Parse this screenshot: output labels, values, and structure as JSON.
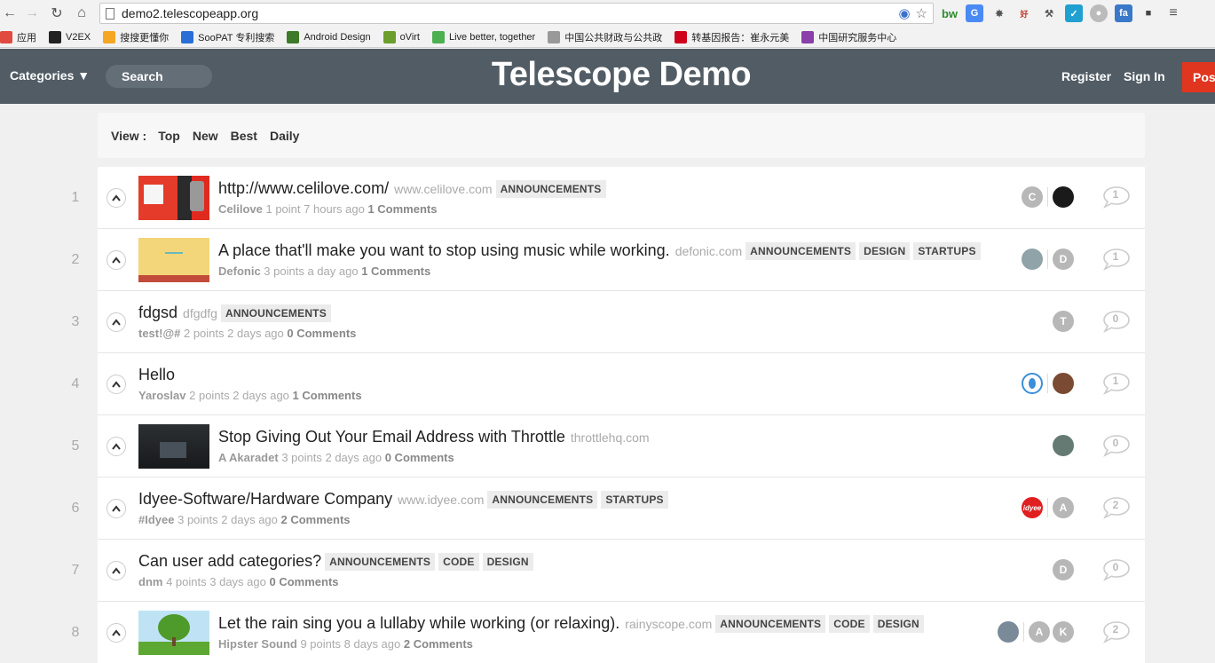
{
  "browser": {
    "url": "demo2.telescopeapp.org",
    "bookmarks": [
      {
        "label": "应用",
        "icon": "apps-grid-icon",
        "color": "#e04a3f"
      },
      {
        "label": "V2EX",
        "icon": "v2ex-icon",
        "color": "#222222"
      },
      {
        "label": "搜搜更懂你",
        "icon": "soso-icon",
        "color": "#f5a623"
      },
      {
        "label": "SooPAT 专利搜索",
        "icon": "soopat-icon",
        "color": "#2a6fd6"
      },
      {
        "label": "Android Design",
        "icon": "android-design-icon",
        "color": "#3d7a2a"
      },
      {
        "label": "oVirt",
        "icon": "ovirt-icon",
        "color": "#6b9e2c"
      },
      {
        "label": "Live better, together",
        "icon": "live-better-icon",
        "color": "#4caf50"
      },
      {
        "label": "中国公共财政与公共政",
        "icon": "page-icon",
        "color": "#999999"
      },
      {
        "label": "转基因报告：崔永元美",
        "icon": "video-icon",
        "color": "#d0021b"
      },
      {
        "label": "中国研究服务中心",
        "icon": "usc-icon",
        "color": "#8b3fa8"
      }
    ]
  },
  "header": {
    "categories_label": "Categories ▼",
    "search_placeholder": "Search",
    "site_title": "Telescope Demo",
    "register_label": "Register",
    "signin_label": "Sign In",
    "post_label": "Post"
  },
  "view_bar": {
    "label": "View :",
    "options": [
      "Top",
      "New",
      "Best",
      "Daily"
    ]
  },
  "posts": [
    {
      "rank": "1",
      "title": "http://www.celilove.com/",
      "domain": "www.celilove.com",
      "tags": [
        "ANNOUNCEMENTS"
      ],
      "author": "Celilove",
      "points": "1 point",
      "time": "7 hours ago",
      "comments_label": "1 Comments",
      "comment_count": "1",
      "thumb": "celilove",
      "avatars": [
        {
          "letter": "C",
          "color": "#b7b7b7"
        },
        {
          "divider": true
        },
        {
          "letter": "",
          "color": "#1a1a1a",
          "photo": "dark"
        }
      ]
    },
    {
      "rank": "2",
      "title": "A place that'll make you want to stop using music while working.",
      "domain": "defonic.com",
      "tags": [
        "ANNOUNCEMENTS",
        "DESIGN",
        "STARTUPS"
      ],
      "author": "Defonic",
      "points": "3 points",
      "time": "a day ago",
      "comments_label": "1 Comments",
      "comment_count": "1",
      "thumb": "defonic",
      "avatars": [
        {
          "letter": "",
          "color": "#8fa3a8",
          "photo": "gray"
        },
        {
          "divider": true
        },
        {
          "letter": "D",
          "color": "#b7b7b7"
        }
      ]
    },
    {
      "rank": "3",
      "title": "fdgsd",
      "domain": "dfgdfg",
      "tags": [
        "ANNOUNCEMENTS"
      ],
      "author": "test!@#",
      "points": "2 points",
      "time": "2 days ago",
      "comments_label": "0 Comments",
      "comment_count": "0",
      "thumb": "",
      "avatars": [
        {
          "letter": "T",
          "color": "#b7b7b7"
        }
      ]
    },
    {
      "rank": "4",
      "title": "Hello",
      "domain": "",
      "tags": [],
      "author": "Yaroslav",
      "points": "2 points",
      "time": "2 days ago",
      "comments_label": "1 Comments",
      "comment_count": "1",
      "thumb": "",
      "avatars": [
        {
          "letter": "",
          "color": "#3a8fd8",
          "photo": "ring"
        },
        {
          "divider": true
        },
        {
          "letter": "",
          "color": "#7a4a32",
          "photo": "brown"
        }
      ]
    },
    {
      "rank": "5",
      "title": "Stop Giving Out Your Email Address with Throttle",
      "domain": "throttlehq.com",
      "tags": [],
      "author": "A Akaradet",
      "points": "3 points",
      "time": "2 days ago",
      "comments_label": "0 Comments",
      "comment_count": "0",
      "thumb": "throttle",
      "avatars": [
        {
          "letter": "",
          "color": "#667a74",
          "photo": "gray"
        }
      ]
    },
    {
      "rank": "6",
      "title": "Idyee-Software/Hardware Company",
      "domain": "www.idyee.com",
      "tags": [
        "ANNOUNCEMENTS",
        "STARTUPS"
      ],
      "author": "#Idyee",
      "points": "3 points",
      "time": "2 days ago",
      "comments_label": "2 Comments",
      "comment_count": "2",
      "thumb": "",
      "avatars": [
        {
          "letter": "idyee",
          "color": "#e02020",
          "photo": "idyee"
        },
        {
          "divider": true
        },
        {
          "letter": "A",
          "color": "#b7b7b7"
        }
      ]
    },
    {
      "rank": "7",
      "title": "Can user add categories?",
      "domain": "",
      "tags": [
        "ANNOUNCEMENTS",
        "CODE",
        "DESIGN"
      ],
      "author": "dnm",
      "points": "4 points",
      "time": "3 days ago",
      "comments_label": "0 Comments",
      "comment_count": "0",
      "thumb": "",
      "avatars": [
        {
          "letter": "D",
          "color": "#b7b7b7"
        }
      ]
    },
    {
      "rank": "8",
      "title": "Let the rain sing you a lullaby while working (or relaxing).",
      "domain": "rainyscope.com",
      "tags": [
        "ANNOUNCEMENTS",
        "CODE",
        "DESIGN"
      ],
      "author": "Hipster Sound",
      "points": "9 points",
      "time": "8 days ago",
      "comments_label": "2 Comments",
      "comment_count": "2",
      "thumb": "tree",
      "avatars": [
        {
          "letter": "",
          "color": "#7a8a99",
          "photo": "gray"
        },
        {
          "divider": true
        },
        {
          "letter": "A",
          "color": "#b7b7b7"
        },
        {
          "letter": "K",
          "color": "#b7b7b7"
        }
      ]
    }
  ]
}
